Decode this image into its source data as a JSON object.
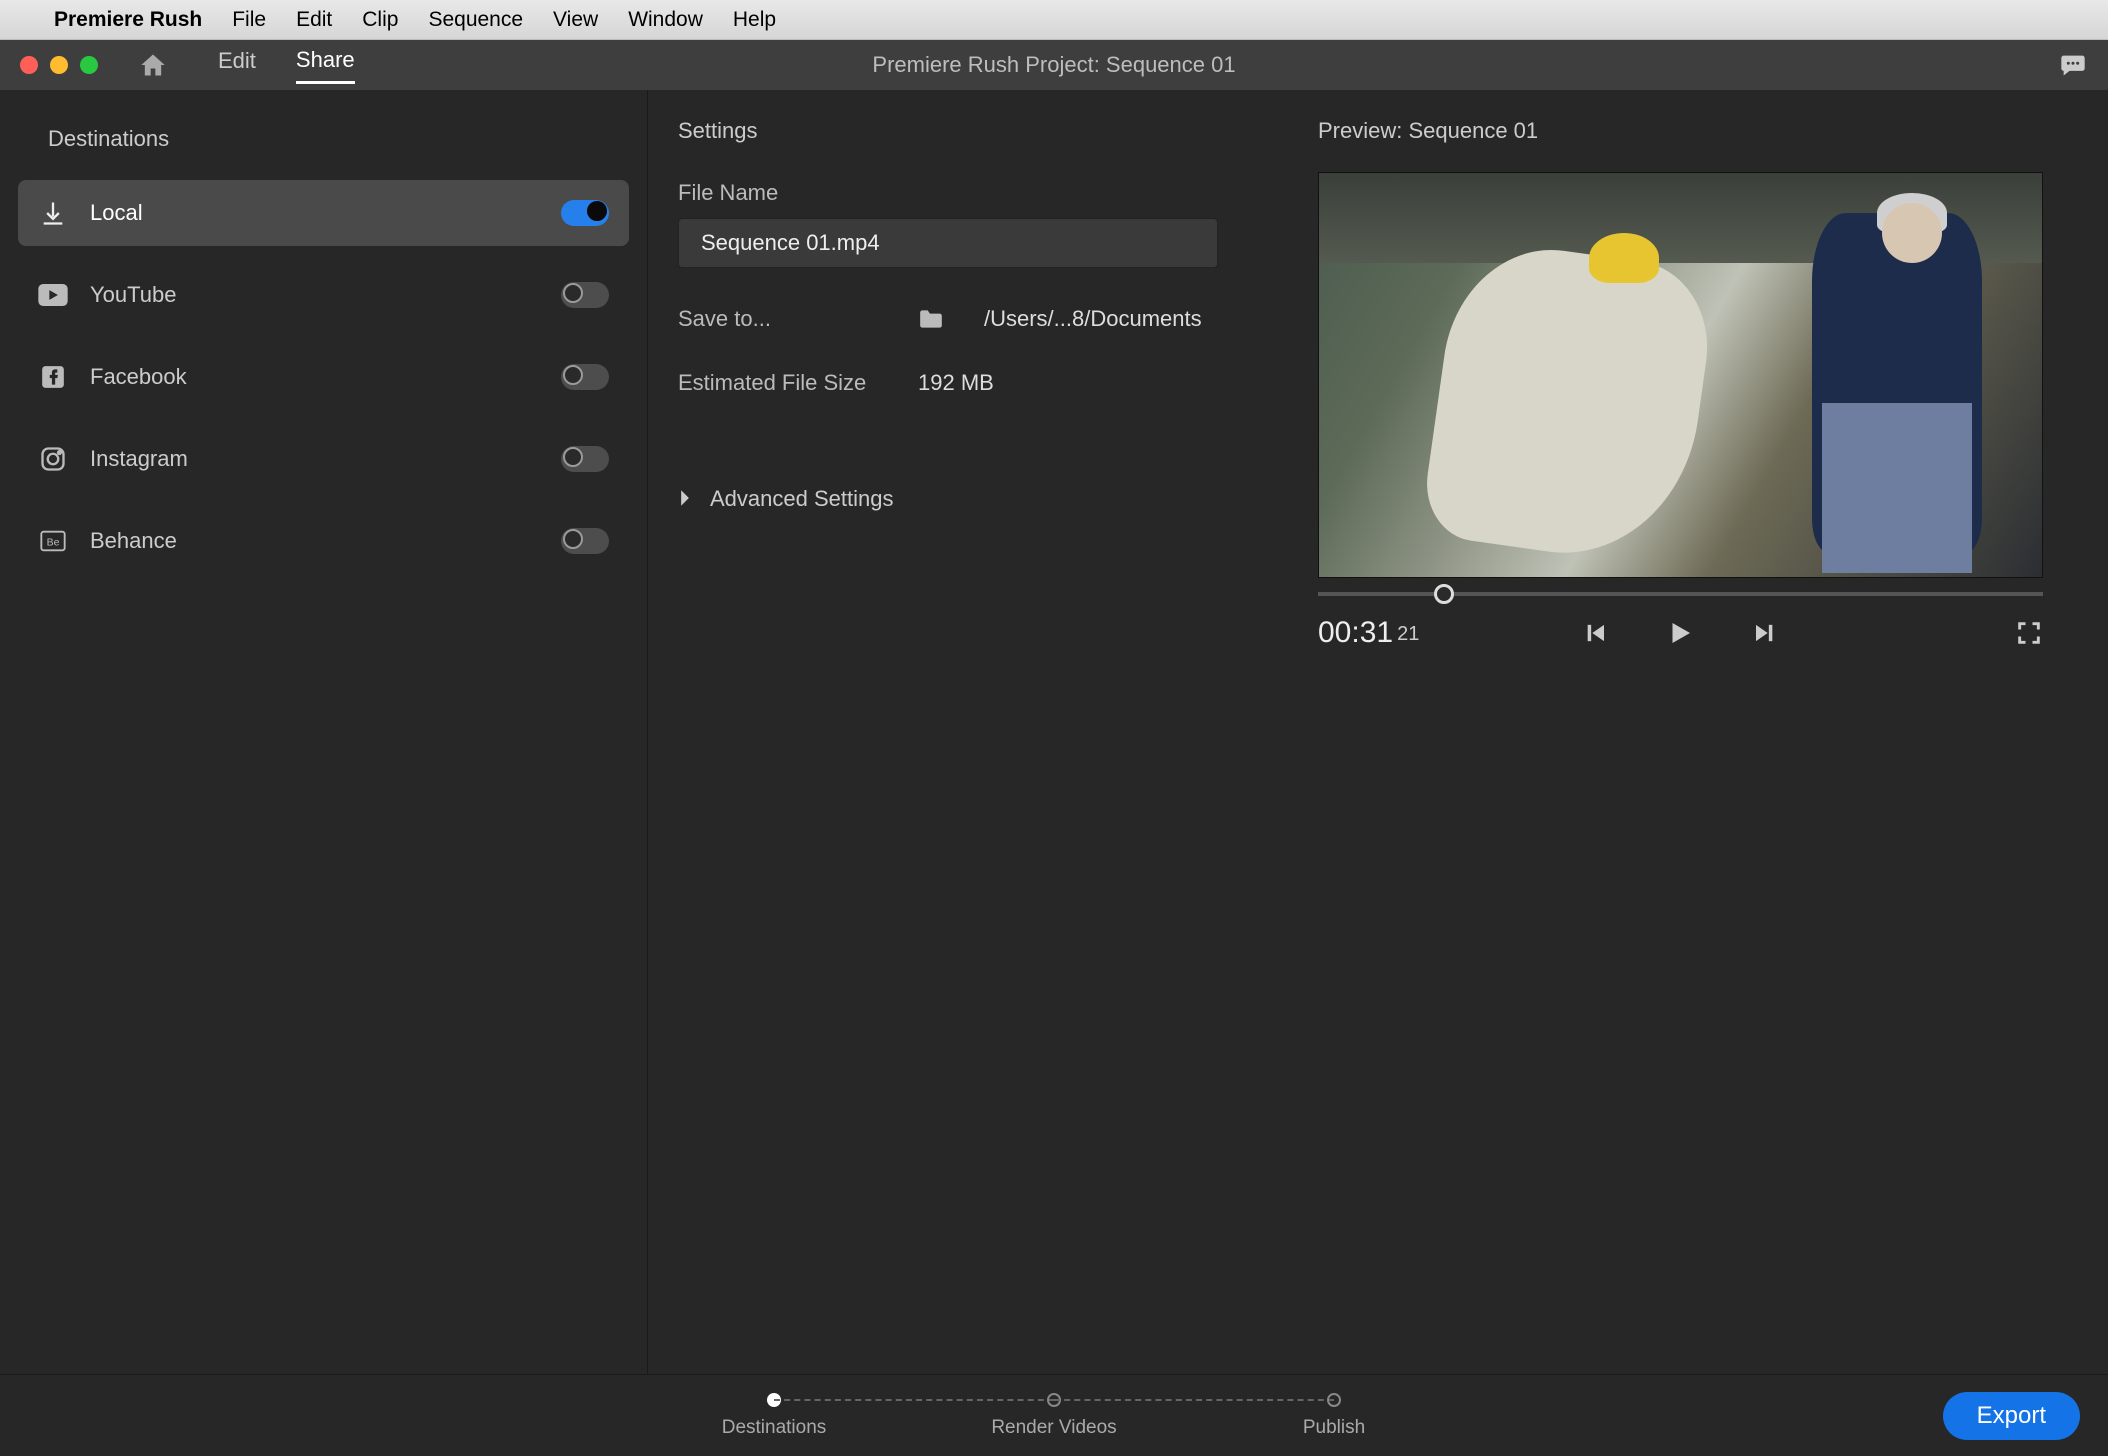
{
  "menubar": {
    "app_name": "Premiere Rush",
    "items": [
      "File",
      "Edit",
      "Clip",
      "Sequence",
      "View",
      "Window",
      "Help"
    ]
  },
  "window": {
    "tabs": {
      "edit": "Edit",
      "share": "Share"
    },
    "title": "Premiere Rush Project: Sequence 01"
  },
  "sidebar": {
    "heading": "Destinations",
    "items": [
      {
        "label": "Local",
        "icon": "download-icon",
        "on": true,
        "selected": true
      },
      {
        "label": "YouTube",
        "icon": "youtube-icon",
        "on": false,
        "selected": false
      },
      {
        "label": "Facebook",
        "icon": "facebook-icon",
        "on": false,
        "selected": false
      },
      {
        "label": "Instagram",
        "icon": "instagram-icon",
        "on": false,
        "selected": false
      },
      {
        "label": "Behance",
        "icon": "behance-icon",
        "on": false,
        "selected": false
      }
    ]
  },
  "settings": {
    "heading": "Settings",
    "file_name_label": "File Name",
    "file_name_value": "Sequence 01.mp4",
    "save_to_label": "Save to...",
    "save_to_path": "/Users/...8/Documents",
    "est_size_label": "Estimated File Size",
    "est_size_value": "192 MB",
    "advanced_label": "Advanced Settings"
  },
  "preview": {
    "heading": "Preview: Sequence 01",
    "timecode": "00:31",
    "frames": "21",
    "playhead_percent": 16
  },
  "footer": {
    "steps": [
      "Destinations",
      "Render Videos",
      "Publish"
    ],
    "active_step": 0,
    "export_label": "Export"
  }
}
